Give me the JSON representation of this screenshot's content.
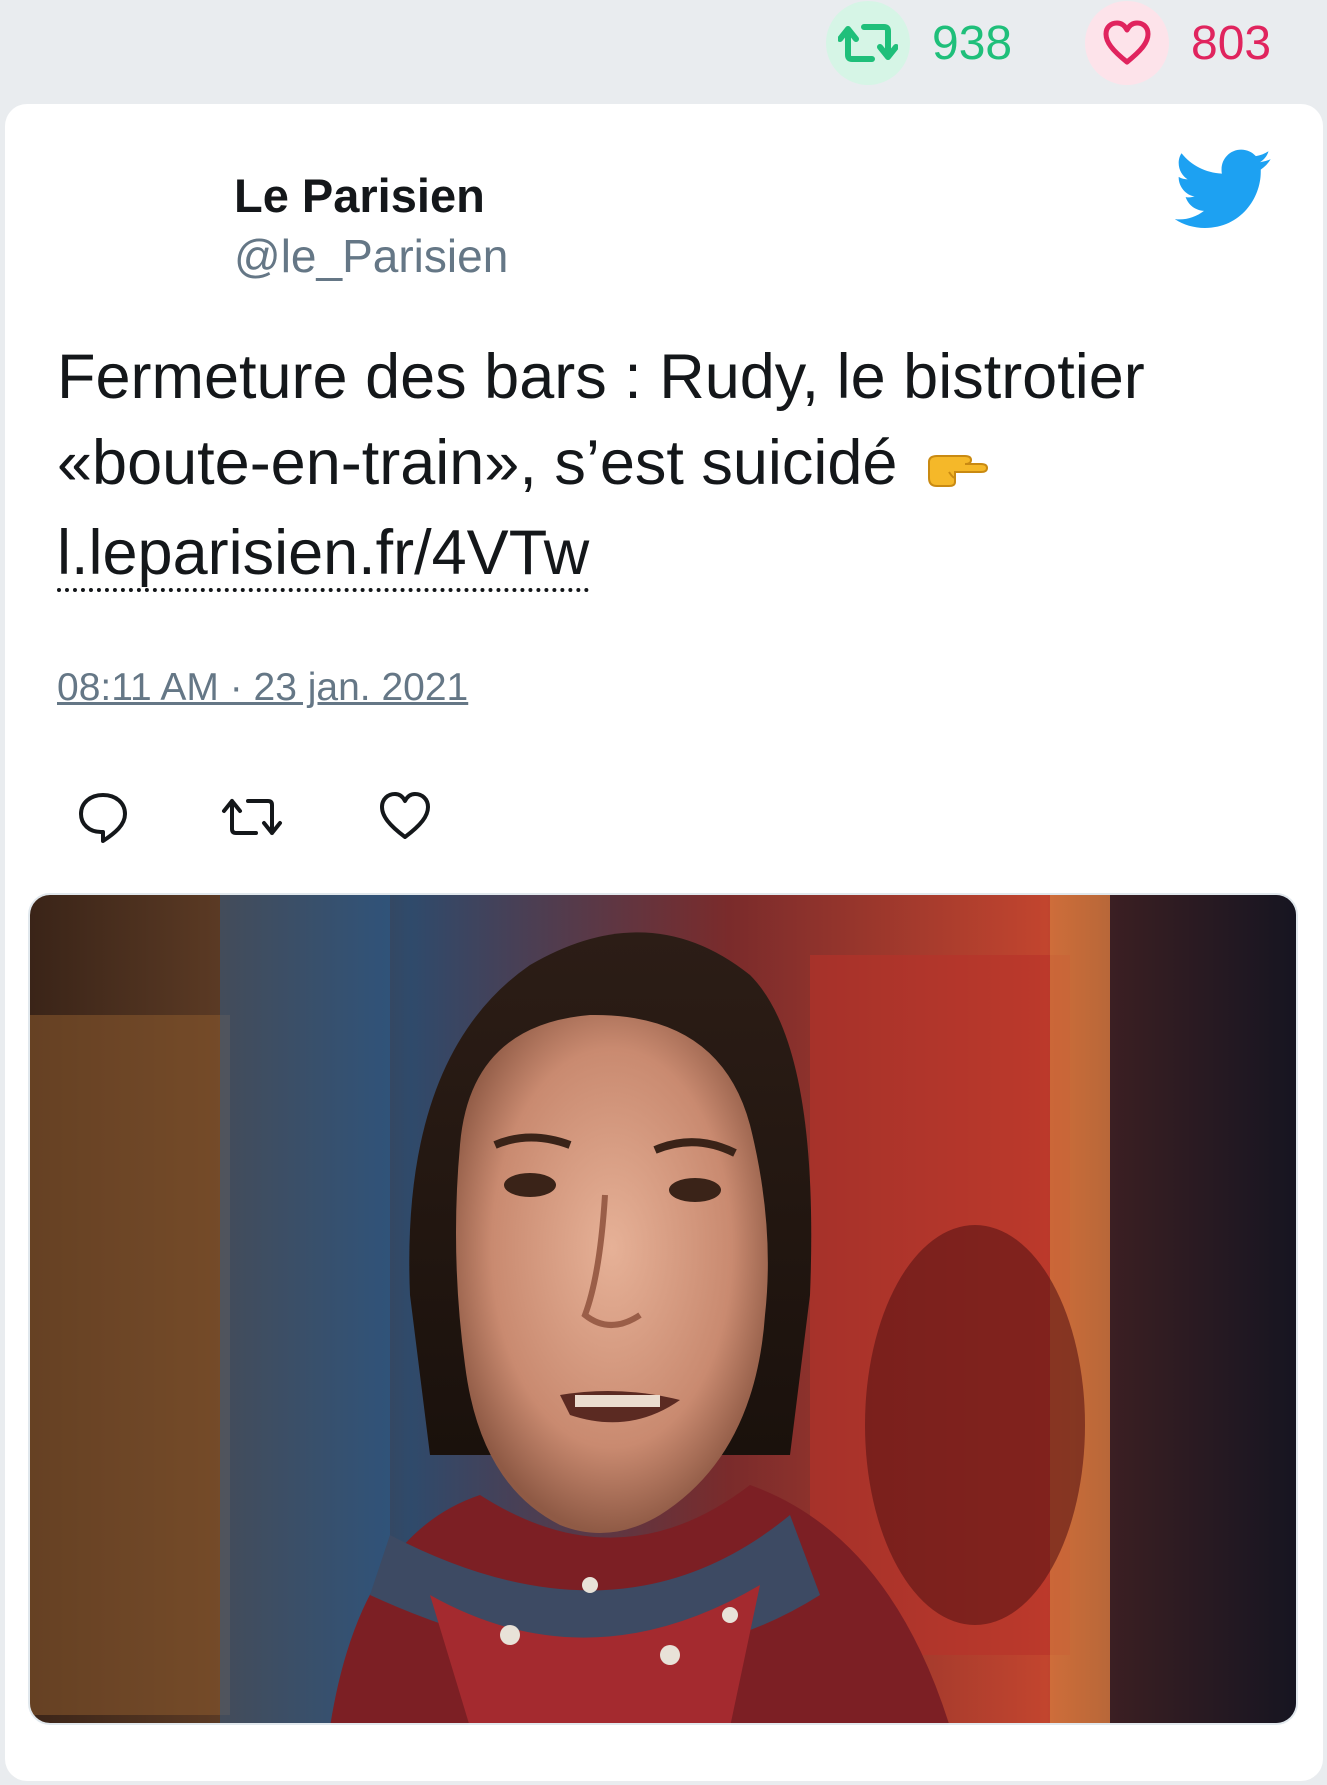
{
  "stats": {
    "retweets": "938",
    "likes": "803"
  },
  "tweet": {
    "author_name": "Le Parisien",
    "author_handle": "@le_Parisien",
    "text": "Fermeture des bars : Rudy, le bistrotier «boute-en-train», s’est suicidé",
    "link": "l.leparisien.fr/4VTw",
    "timestamp": "08:11 AM · 23 jan. 2021"
  },
  "media": {
    "description": "photo"
  },
  "colors": {
    "retweet_green": "#1fbf7a",
    "like_red": "#e0245e",
    "twitter_blue": "#1da1f2",
    "muted_gray": "#657786"
  },
  "icons": [
    "retweet-icon",
    "heart-icon",
    "twitter-bird-icon",
    "pointing-hand-icon",
    "reply-icon"
  ]
}
